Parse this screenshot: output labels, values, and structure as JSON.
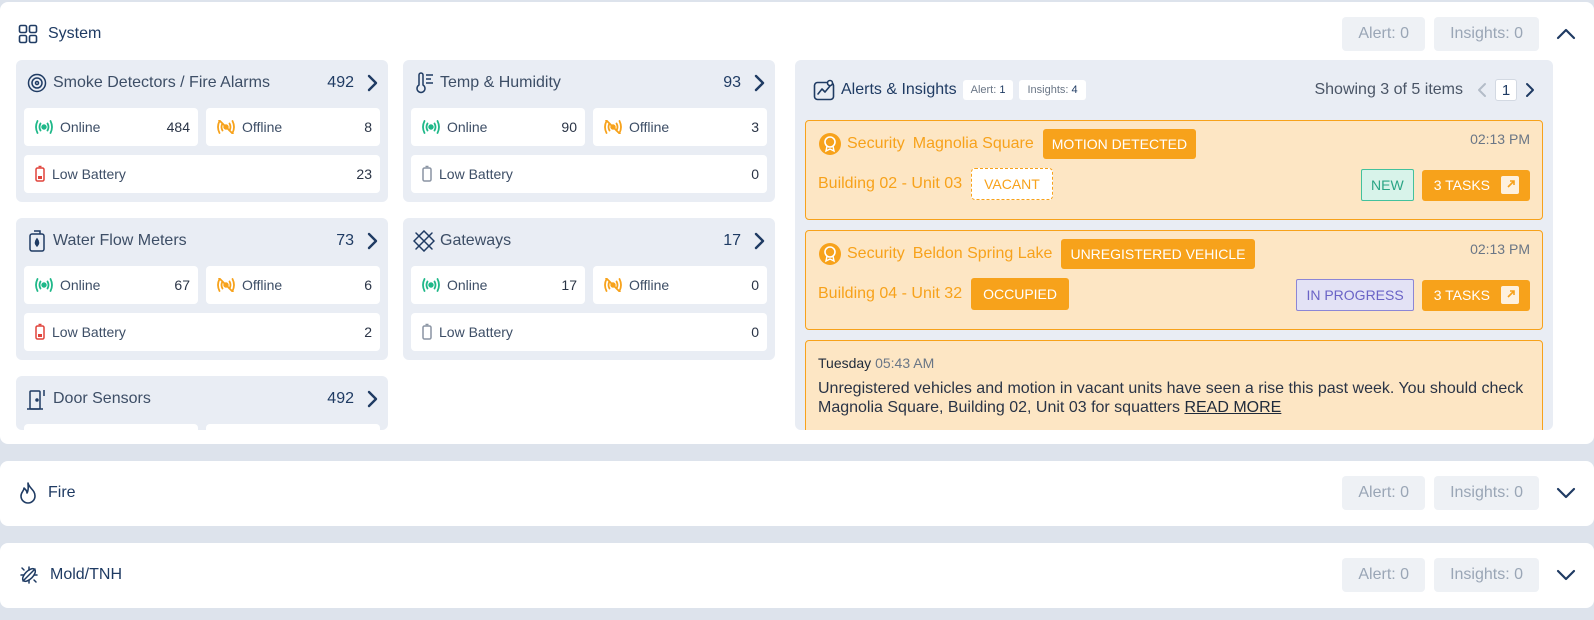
{
  "system": {
    "title": "System",
    "alert_label": "Alert: 0",
    "insights_label": "Insights: 0",
    "cards": [
      {
        "title": "Smoke Detectors / Fire Alarms",
        "count": "492",
        "online_label": "Online",
        "online": "484",
        "offline_label": "Offline",
        "offline": "8",
        "battery_label": "Low Battery",
        "battery": "23"
      },
      {
        "title": "Temp & Humidity",
        "count": "93",
        "online_label": "Online",
        "online": "90",
        "offline_label": "Offline",
        "offline": "3",
        "battery_label": "Low Battery",
        "battery": "0"
      },
      {
        "title": "Water Flow Meters",
        "count": "73",
        "online_label": "Online",
        "online": "67",
        "offline_label": "Offline",
        "offline": "6",
        "battery_label": "Low Battery",
        "battery": "2"
      },
      {
        "title": "Gateways",
        "count": "17",
        "online_label": "Online",
        "online": "17",
        "offline_label": "Offline",
        "offline": "0",
        "battery_label": "Low Battery",
        "battery": "0"
      },
      {
        "title": "Door Sensors",
        "count": "492"
      }
    ],
    "alerts": {
      "title": "Alerts & Insights",
      "alert_tag": "Alert:",
      "alert_count": "1",
      "insights_tag": "Insights:",
      "insights_count": "4",
      "showing": "Showing 3 of 5 items",
      "page": "1",
      "items": [
        {
          "category": "Security",
          "place": "Magnolia Square",
          "event": "MOTION DETECTED",
          "time": "02:13 PM",
          "unit": "Building 02 - Unit 03",
          "occupancy": "VACANT",
          "status": "NEW",
          "tasks": "3 TASKS"
        },
        {
          "category": "Security",
          "place": "Beldon Spring Lake",
          "event": "UNREGISTERED VEHICLE",
          "time": "02:13 PM",
          "unit": "Building 04 - Unit 32",
          "occupancy": "OCCUPIED",
          "status": "IN PROGRESS",
          "tasks": "3 TASKS"
        }
      ],
      "insight": {
        "day": "Tuesday",
        "time": "05:43 AM",
        "text": "Unregistered vehicles and motion in vacant units have seen a rise this past week. You should check Magnolia Square, Building 02, Unit 03 for squatters",
        "link": "READ MORE"
      }
    }
  },
  "fire": {
    "title": "Fire",
    "alert_label": "Alert: 0",
    "insights_label": "Insights: 0"
  },
  "mold": {
    "title": "Mold/TNH",
    "alert_label": "Alert: 0",
    "insights_label": "Insights: 0"
  },
  "colors": {
    "accent": "#f7a21b",
    "navy": "#1f3b63",
    "online": "#1fb889",
    "battery_low": "#e0433b"
  }
}
